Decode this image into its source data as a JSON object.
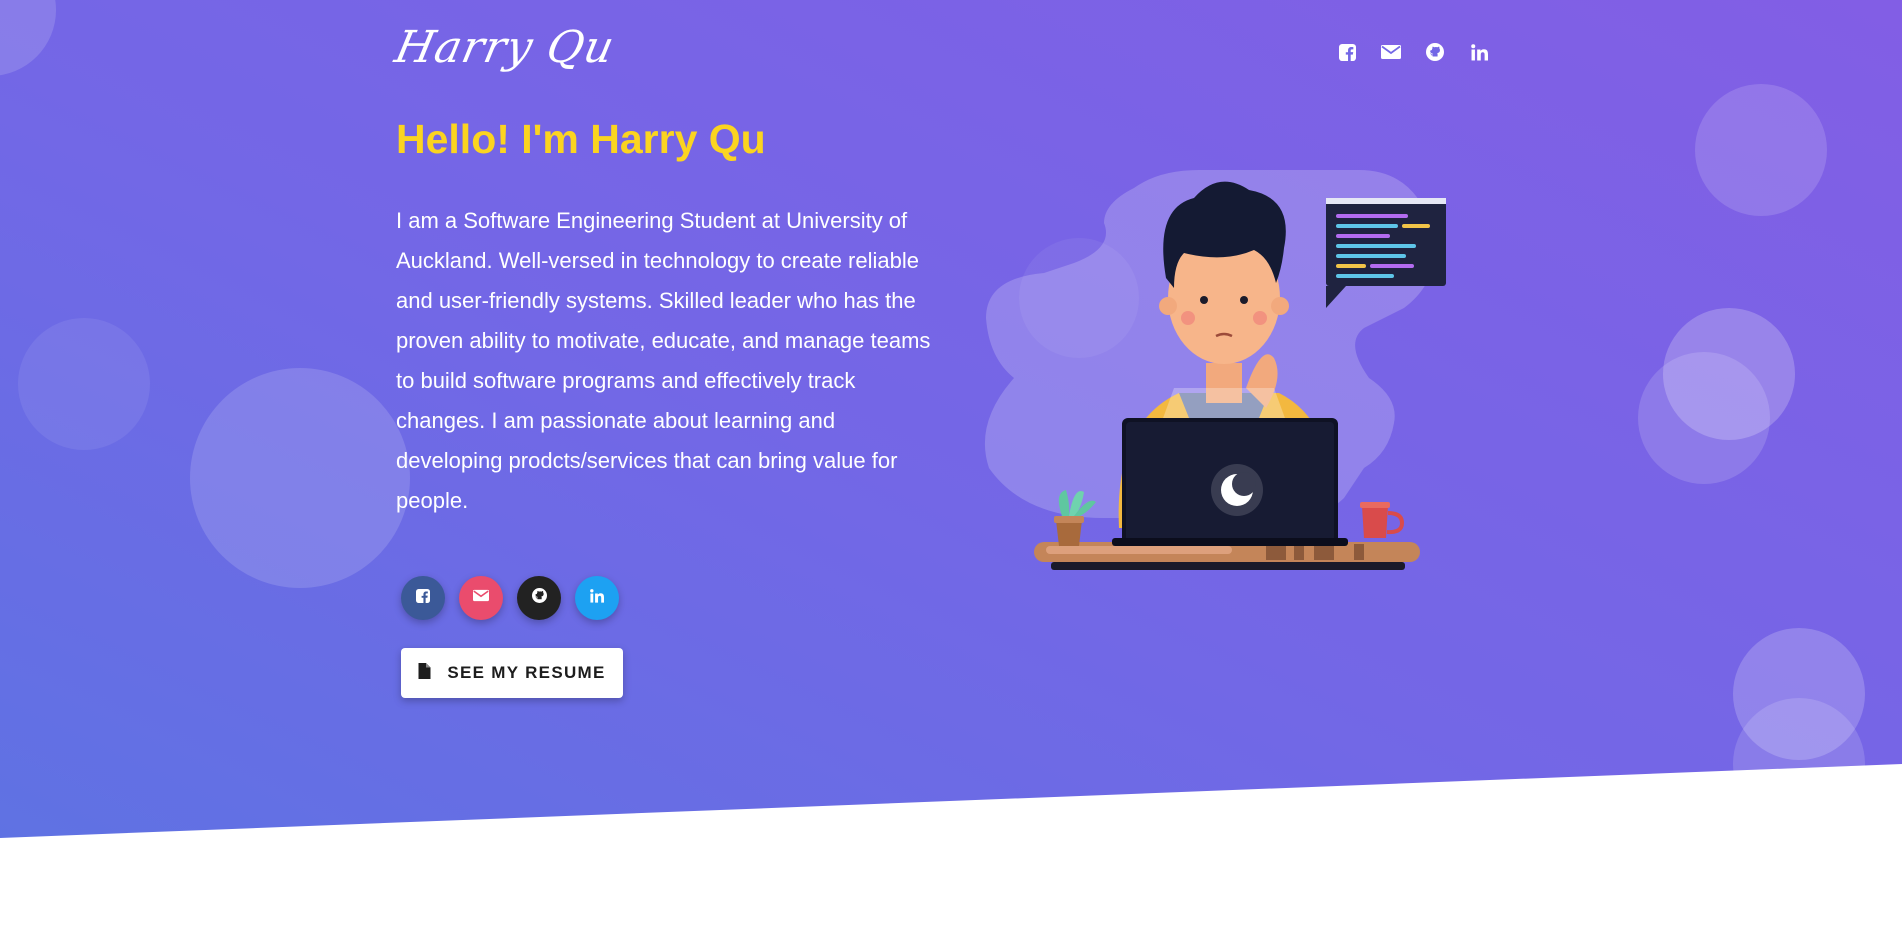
{
  "brand": {
    "logo_text": "Harry Qu"
  },
  "hero": {
    "greeting": "Hello! I'm Harry Qu",
    "bio": "I am a Software Engineering Student at University of Auckland. Well-versed in technology to create reliable and user-friendly systems. Skilled leader who has the proven ability to motivate, educate, and manage teams to build software programs and effectively track changes. I am passionate about learning and developing prodcts/services that can bring value for people."
  },
  "top_social": {
    "icons": [
      "facebook-icon",
      "mail-icon",
      "github-icon",
      "linkedin-icon"
    ]
  },
  "social_buttons": [
    {
      "icon": "facebook-icon",
      "color": "#3b5998"
    },
    {
      "icon": "mail-icon",
      "color": "#ea4c6d"
    },
    {
      "icon": "github-icon",
      "color": "#222222"
    },
    {
      "icon": "linkedin-icon",
      "color": "#1da1f2"
    }
  ],
  "resume_button": {
    "label": "SEE MY RESUME",
    "icon": "file-icon"
  },
  "colors": {
    "greeting": "#fbd420",
    "gradient_start": "#5f72e3",
    "gradient_end": "#825ee5"
  }
}
